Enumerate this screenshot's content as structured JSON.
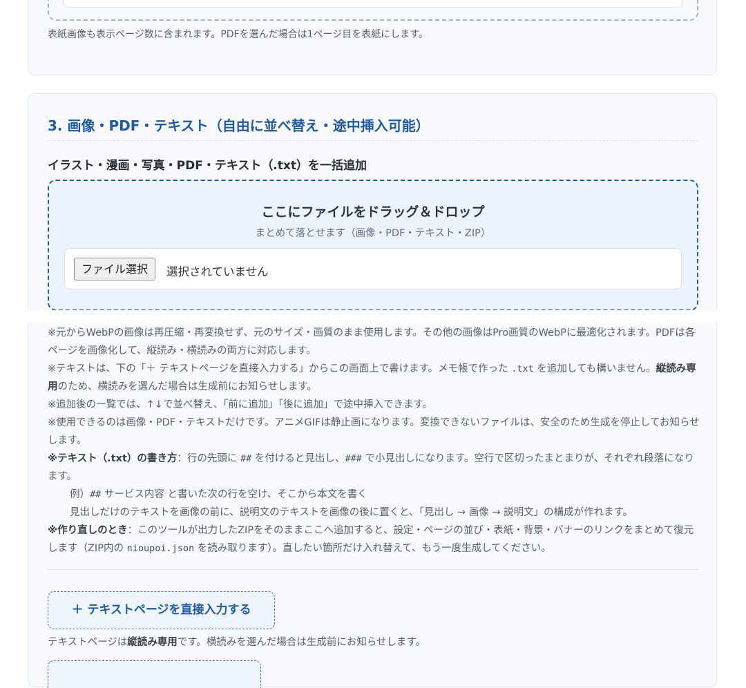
{
  "previous_section": {
    "note": "表紙画像も表示ページ数に含まれます。PDFを選んだ場合は1ページ目を表紙にします。"
  },
  "section3": {
    "title": "3. 画像・PDF・テキスト（自由に並べ替え・途中挿入可能）",
    "subtitle": "イラスト・漫画・写真・PDF・テキスト（.txt）を一括追加",
    "dropzone": {
      "title": "ここにファイルをドラッグ＆ドロップ",
      "subtitle": "まとめて落とせます（画像・PDF・テキスト・ZIP）",
      "file_button": "ファイル選択",
      "file_status": "選択されていません"
    },
    "notes": {
      "n1": "※元からWebPの画像は再圧縮・再変換せず、元のサイズ・画質のまま使用します。その他の画像はPro画質のWebPに最適化されます。PDFは各ページを画像化して、縦読み・横読みの両方に対応します。",
      "n2a": "※テキストは、下の「＋ テキストページを直接入力する」からこの画面上で書けます。メモ帳で作った ",
      "n2_code": ".txt",
      "n2b": " を追加しても構いません。",
      "n2_bold": "縦読み専用",
      "n2c": "のため、横読みを選んだ場合は生成前にお知らせします。",
      "n3": "※追加後の一覧では、↑↓で並べ替え、「前に追加」「後に追加」で途中挿入できます。",
      "n4": "※使用できるのは画像・PDF・テキストだけです。アニメGIFは静止画になります。変換できないファイルは、安全のため生成を停止してお知らせします。",
      "n5_bold": "※テキスト（.txt）の書き方",
      "n5a": "：行の先頭に ",
      "n5_code1": "##",
      "n5b": " を付けると見出し、",
      "n5_code2": "###",
      "n5c": " で小見出しになります。空行で区切ったまとまりが、それぞれ段落になります。",
      "ex1a": "例）",
      "ex1_code": "##",
      "ex1b": " サービス内容 と書いた次の行を空け、そこから本文を書く",
      "ex2": "見出しだけのテキストを画像の前に、説明文のテキストを画像の後に置くと、「見出し → 画像 → 説明文」の構成が作れます。",
      "n6_bold": "※作り直しのとき",
      "n6a": "：このツールが出力したZIPをそのままここへ追加すると、設定・ページの並び・表紙・背景・バナーのリンクをまとめて復元します（ZIP内の ",
      "n6_code": "nioupoi.json",
      "n6b": " を読み取ります）。直したい箇所だけ入れ替えて、もう一度生成してください。"
    },
    "add_text_button": "＋ テキストページを直接入力する",
    "add_text_note_a": "テキストページは",
    "add_text_note_bold": "縦読み専用",
    "add_text_note_b": "です。横読みを選んだ場合は生成前にお知らせします。"
  }
}
